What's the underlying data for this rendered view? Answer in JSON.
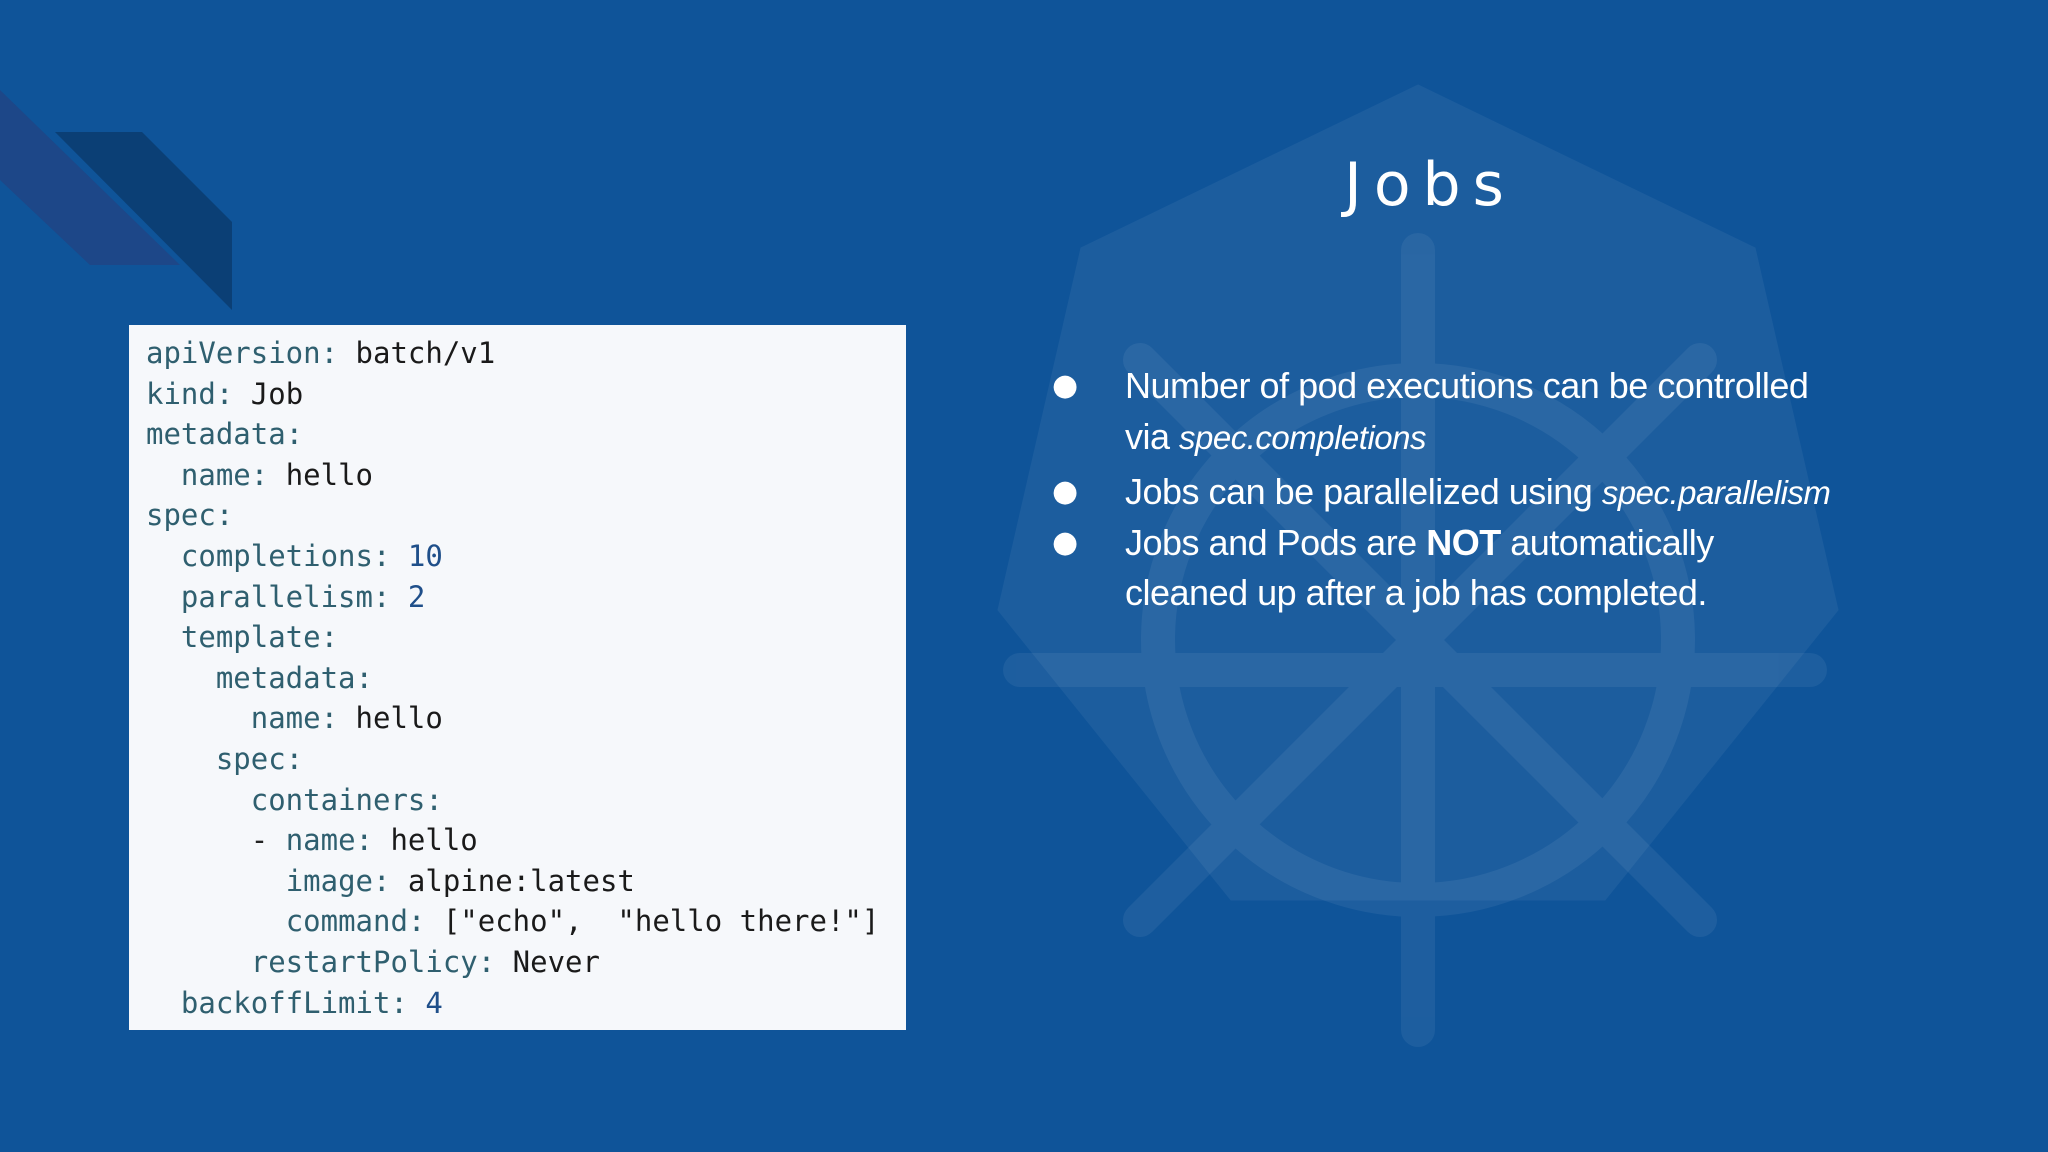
{
  "slide": {
    "title": "Jobs",
    "colors": {
      "background": "#0f5499",
      "accent_dark": "#0b3f75",
      "accent_mid": "#1d4788",
      "code_bg": "#f6f8fb"
    },
    "code": [
      {
        "indent": "",
        "key": "apiVersion:",
        "val": " batch/v1"
      },
      {
        "indent": "",
        "key": "kind:",
        "val": " Job"
      },
      {
        "indent": "",
        "key": "metadata:",
        "val": ""
      },
      {
        "indent": "  ",
        "key": "name:",
        "val": " hello"
      },
      {
        "indent": "",
        "key": "spec:",
        "val": ""
      },
      {
        "indent": "  ",
        "key": "completions:",
        "val": " 10"
      },
      {
        "indent": "  ",
        "key": "parallelism:",
        "val": " 2"
      },
      {
        "indent": "  ",
        "key": "template:",
        "val": ""
      },
      {
        "indent": "    ",
        "key": "metadata:",
        "val": ""
      },
      {
        "indent": "      ",
        "key": "name:",
        "val": " hello"
      },
      {
        "indent": "    ",
        "key": "spec:",
        "val": ""
      },
      {
        "indent": "      ",
        "key": "containers:",
        "val": ""
      },
      {
        "indent": "      - ",
        "key": "name:",
        "val": " hello"
      },
      {
        "indent": "        ",
        "key": "image:",
        "val": " alpine:latest"
      },
      {
        "indent": "        ",
        "key": "command:",
        "val": " [\"echo\",  \"hello there!\"]"
      },
      {
        "indent": "      ",
        "key": "restartPolicy:",
        "val": " Never"
      },
      {
        "indent": "  ",
        "key": "backoffLimit:",
        "val": " 4"
      }
    ],
    "bullets": [
      {
        "line1": "Number of pod executions can be controlled",
        "line2_prefix": "via ",
        "line2_em": "spec.completions"
      },
      {
        "text_prefix": "Jobs can be parallelized using ",
        "text_em": "spec.parallelism"
      },
      {
        "text_prefix": "Jobs and Pods are ",
        "text_strong": "NOT",
        "text_suffix": " automatically",
        "line2": "cleaned up after a job has completed."
      }
    ],
    "bullet_glyph": "●"
  }
}
